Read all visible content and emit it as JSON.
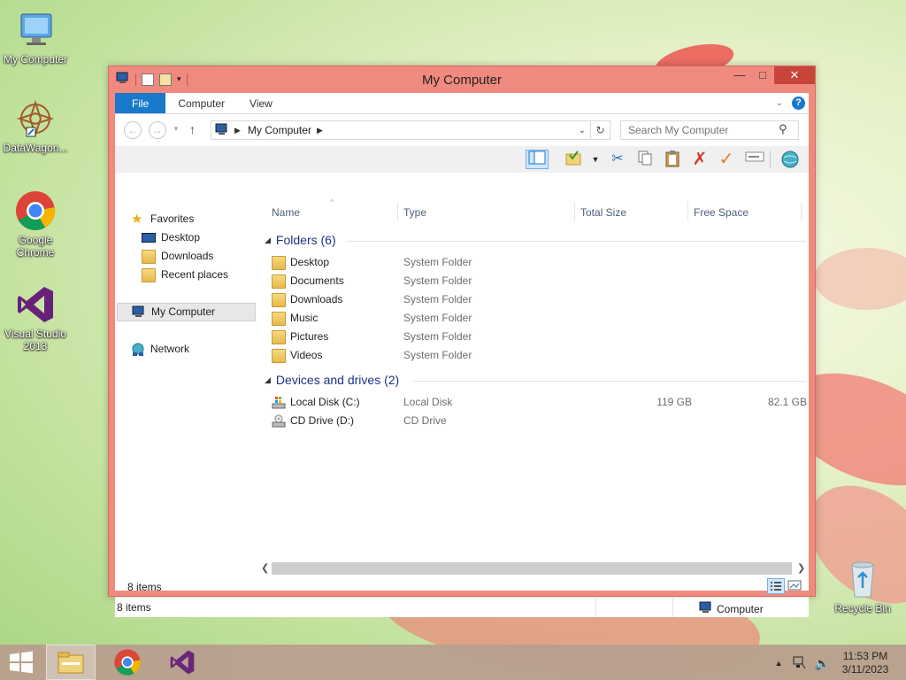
{
  "desktop": {
    "icons": [
      {
        "label": "My Computer"
      },
      {
        "label": "DataWagon..."
      },
      {
        "label": "Google Chrome"
      },
      {
        "label": "Visual Studio 2013"
      },
      {
        "label": "Recycle Bin"
      }
    ]
  },
  "window": {
    "title": "My Computer",
    "ribbon": {
      "tabs": [
        "File",
        "Computer",
        "View"
      ]
    },
    "address": {
      "crumb": "My Computer"
    },
    "search": {
      "placeholder": "Search My Computer"
    },
    "columns": [
      "Name",
      "Type",
      "Total Size",
      "Free Space"
    ],
    "nav": {
      "favorites": "Favorites",
      "items": [
        "Desktop",
        "Downloads",
        "Recent places"
      ],
      "computer": "My Computer",
      "network": "Network"
    },
    "groups": {
      "folders": {
        "title": "Folders (6)",
        "items": [
          {
            "name": "Desktop",
            "type": "System Folder"
          },
          {
            "name": "Documents",
            "type": "System Folder"
          },
          {
            "name": "Downloads",
            "type": "System Folder"
          },
          {
            "name": "Music",
            "type": "System Folder"
          },
          {
            "name": "Pictures",
            "type": "System Folder"
          },
          {
            "name": "Videos",
            "type": "System Folder"
          }
        ]
      },
      "drives": {
        "title": "Devices and drives (2)",
        "items": [
          {
            "name": "Local Disk (C:)",
            "type": "Local Disk",
            "total": "119 GB",
            "free": "82.1 GB"
          },
          {
            "name": "CD Drive (D:)",
            "type": "CD Drive",
            "total": "",
            "free": ""
          }
        ]
      }
    },
    "status": {
      "items_line": "8 items",
      "bar_left": "8 items",
      "bar_right": "Computer"
    }
  },
  "taskbar": {
    "time": "11:53 PM",
    "date": "3/11/2023"
  },
  "colors": {
    "accent": "#1979ca",
    "window_frame": "#f08a7e",
    "close_button": "#c7453b",
    "group_header": "#1e3287"
  }
}
